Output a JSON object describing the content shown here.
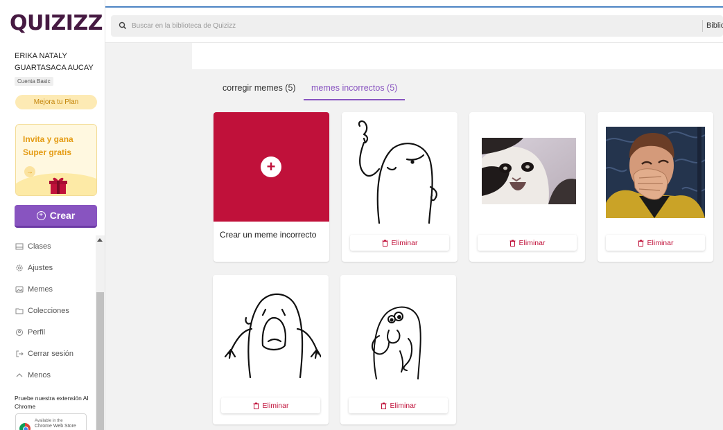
{
  "app": {
    "logo": "QUIZIZZ",
    "accent": "#8854c0",
    "meme_red": "#c0113a"
  },
  "sidebar": {
    "user_name": "ERIKA NATALY GUARTASACA AUCAY",
    "plan": "Cuenta Basic",
    "upgrade_label": "Mejora tu Plan",
    "invite": {
      "line1": "Invita y gana",
      "line2": "Super gratis"
    },
    "create_label": "Crear",
    "nav": [
      {
        "label": "Clases",
        "icon": "classroom-icon"
      },
      {
        "label": "Ajustes",
        "icon": "gear-icon"
      },
      {
        "label": "Memes",
        "icon": "image-icon"
      },
      {
        "label": "Colecciones",
        "icon": "folder-icon"
      },
      {
        "label": "Perfil",
        "icon": "profile-icon"
      },
      {
        "label": "Cerrar sesión",
        "icon": "logout-icon"
      },
      {
        "label": "Menos",
        "icon": "chevron-up-icon"
      }
    ],
    "extension_text": "Pruebe nuestra extensión AI Chrome",
    "store_badge": {
      "line1": "Available in the",
      "line2": "Chrome Web Store"
    }
  },
  "search": {
    "placeholder": "Buscar en la biblioteca de Quizizz",
    "library_label": "Biblioteca"
  },
  "tabs": [
    {
      "label": "corregir memes (5)",
      "active": false
    },
    {
      "label": "memes incorrectos (5)",
      "active": true
    }
  ],
  "cards": {
    "create_label": "Crear un meme incorrecto",
    "delete_label": "Eliminar",
    "items": [
      {
        "image": "flork-pointing-meme"
      },
      {
        "image": "crying-cat-meme"
      },
      {
        "image": "laughing-captain-meme"
      },
      {
        "image": "flork-screaming-meme"
      },
      {
        "image": "flork-shocked-meme"
      }
    ]
  }
}
